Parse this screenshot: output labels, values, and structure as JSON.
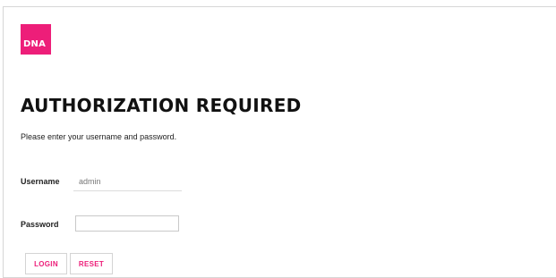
{
  "brand": {
    "logo_text": "DNA",
    "accent_color": "#ed1e79"
  },
  "page": {
    "title": "AUTHORIZATION REQUIRED",
    "subtitle": "Please enter your username and password."
  },
  "form": {
    "username": {
      "label": "Username",
      "value": "admin"
    },
    "password": {
      "label": "Password",
      "value": ""
    },
    "buttons": {
      "login_label": "LOGIN",
      "reset_label": "RESET"
    }
  }
}
